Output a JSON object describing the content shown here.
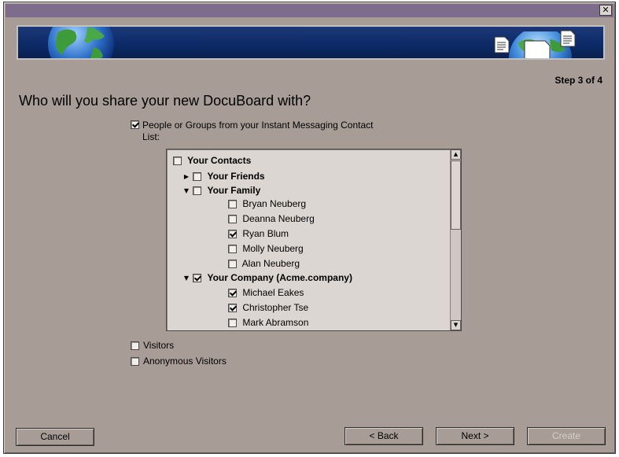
{
  "window": {
    "close_glyph": "✕"
  },
  "header": {
    "step": "Step 3 of 4",
    "title": "Who will you share your new DocuBoard with?"
  },
  "im_contacts": {
    "label": "People or Groups from your Instant Messaging Contact List:",
    "checked": true
  },
  "tree": {
    "root": {
      "label": "Your Contacts",
      "checked": false
    },
    "groups": [
      {
        "label": "Your Friends",
        "checked": false,
        "expanded": false,
        "members": []
      },
      {
        "label": "Your Family",
        "checked": false,
        "expanded": true,
        "members": [
          {
            "name": "Bryan Neuberg",
            "checked": false
          },
          {
            "name": "Deanna Neuberg",
            "checked": false
          },
          {
            "name": "Ryan Blum",
            "checked": true
          },
          {
            "name": "Molly Neuberg",
            "checked": false
          },
          {
            "name": "Alan Neuberg",
            "checked": false
          }
        ]
      },
      {
        "label": "Your Company (Acme.company)",
        "checked": true,
        "expanded": true,
        "members": [
          {
            "name": "Michael Eakes",
            "checked": true
          },
          {
            "name": "Christopher Tse",
            "checked": true
          },
          {
            "name": "Mark Abramson",
            "checked": false
          }
        ]
      }
    ]
  },
  "visitors": {
    "label": "Visitors",
    "checked": false
  },
  "anonymous": {
    "label": "Anonymous Visitors",
    "checked": false
  },
  "buttons": {
    "cancel": "Cancel",
    "back": "< Back",
    "next": "Next >",
    "create": "Create"
  },
  "colors": {
    "window_bg": "#a89d96",
    "title_bar": "#7e6c8c",
    "banner": "#0c2a66",
    "list_bg": "#dcd6d2"
  }
}
